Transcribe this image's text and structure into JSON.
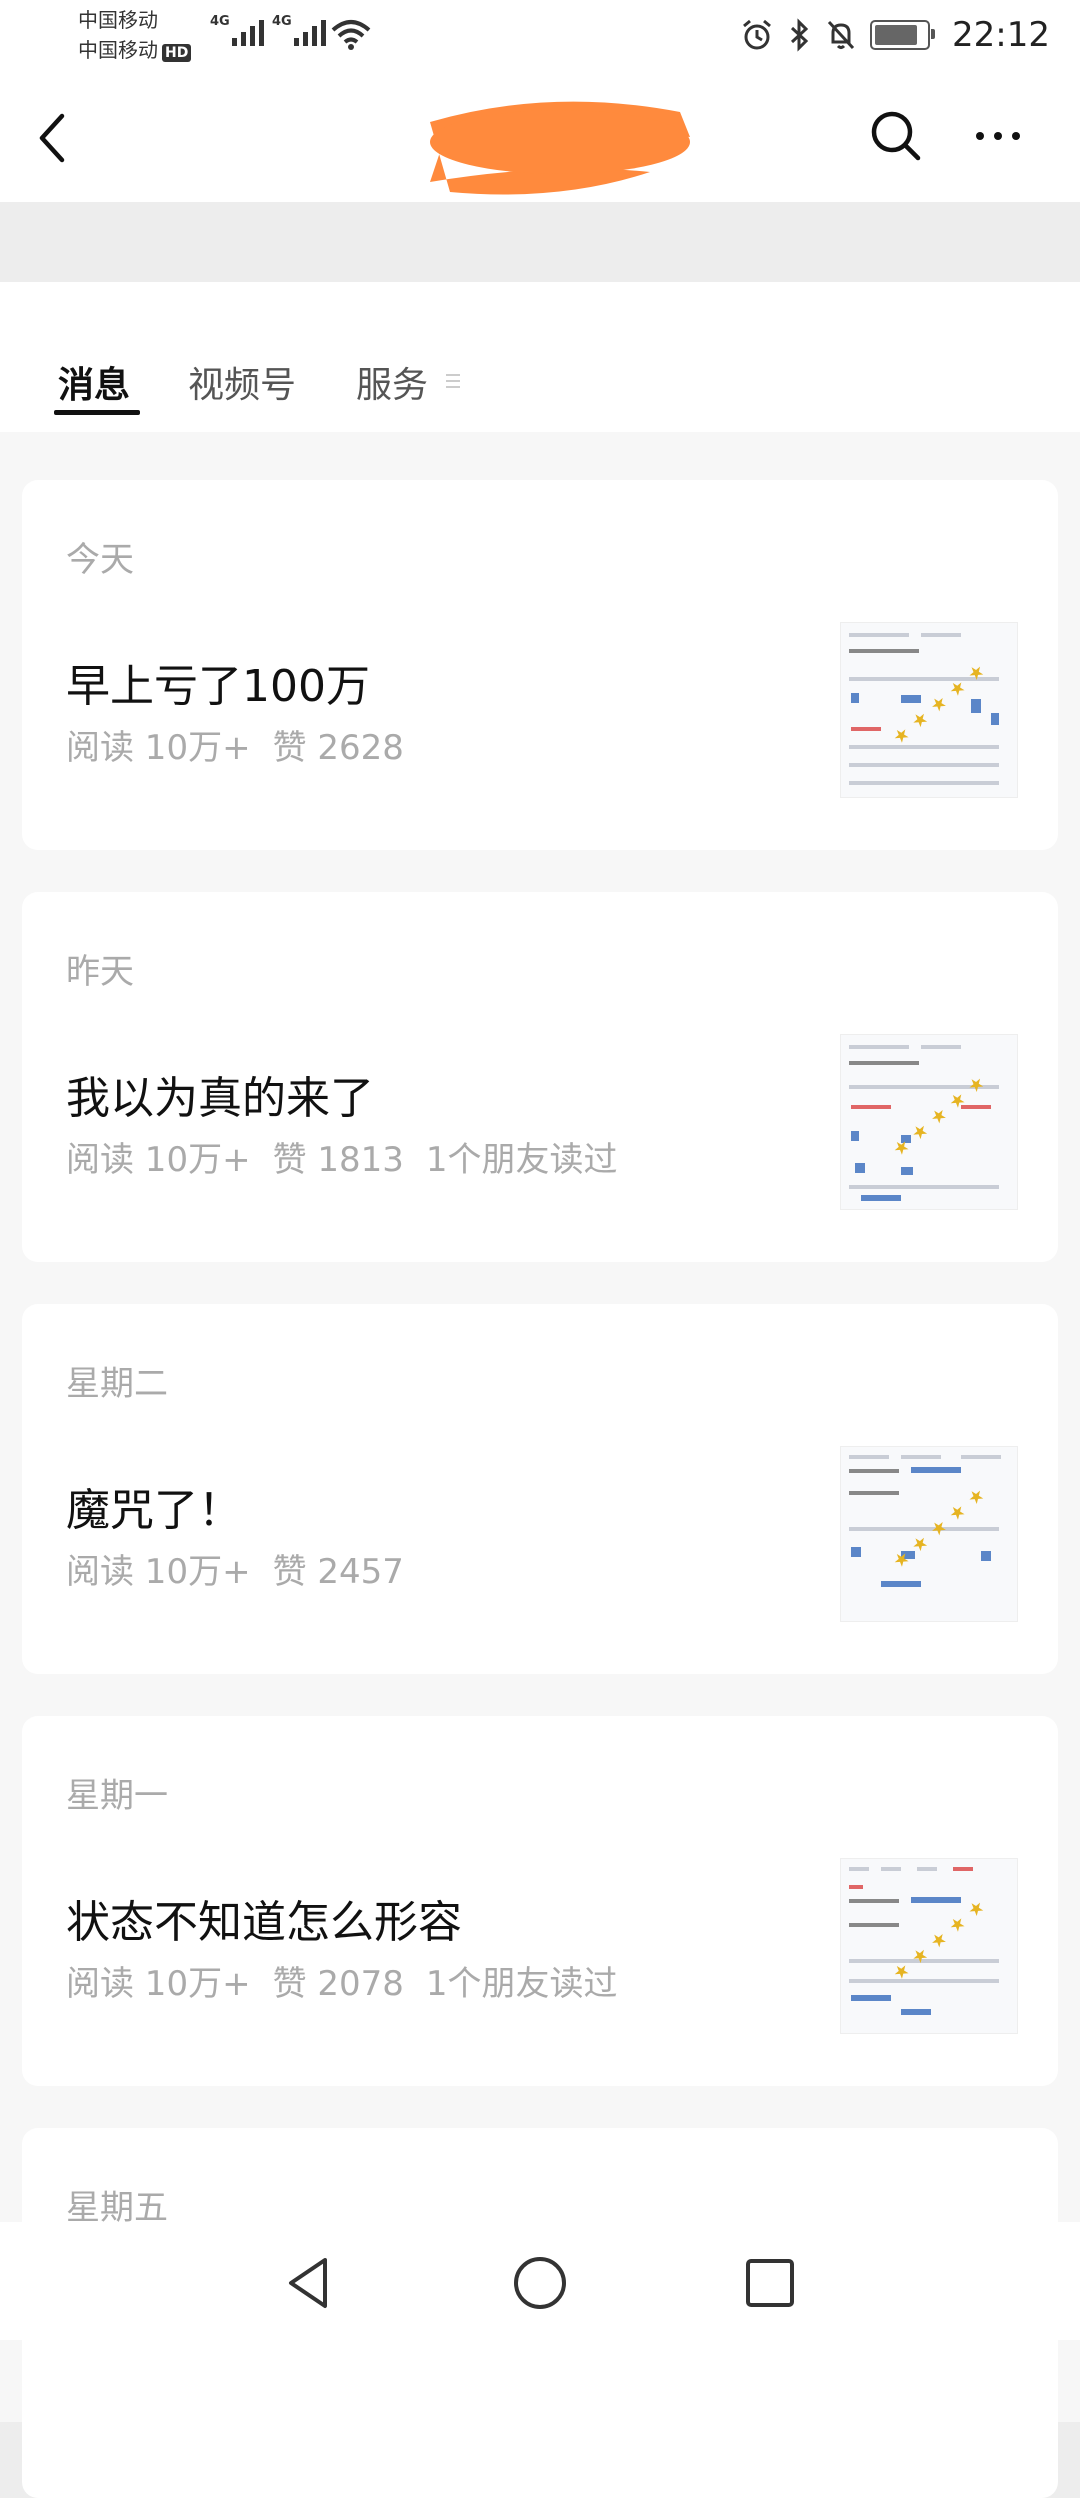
{
  "status_bar": {
    "carrier1": "中国移动",
    "carrier2": "中国移动",
    "hd_badge": "HD",
    "network1": "4G",
    "network2": "4G",
    "time": "22:12"
  },
  "header": {
    "title_redacted": true,
    "icons": [
      "back-icon",
      "search-icon",
      "more-icon"
    ]
  },
  "tabs": [
    {
      "label": "消息",
      "active": true
    },
    {
      "label": "视频号",
      "active": false
    },
    {
      "label": "服务",
      "active": false
    }
  ],
  "articles": [
    {
      "day": "今天",
      "title": "早上亏了100万",
      "reads": "阅读 10万+",
      "likes": "赞 2628",
      "friends": ""
    },
    {
      "day": "昨天",
      "title": "我以为真的来了",
      "reads": "阅读 10万+",
      "likes": "赞 1813",
      "friends": "1个朋友读过"
    },
    {
      "day": "星期二",
      "title": "魔咒了！",
      "reads": "阅读 10万+",
      "likes": "赞 2457",
      "friends": ""
    },
    {
      "day": "星期一",
      "title": "状态不知道怎么形容",
      "reads": "阅读 10万+",
      "likes": "赞 2078",
      "friends": "1个朋友读过"
    },
    {
      "day": "星期五",
      "title": "",
      "reads": "",
      "likes": "",
      "friends": ""
    }
  ],
  "colors": {
    "background": "#ededed",
    "card": "#ffffff",
    "redaction": "#ff8a3d",
    "muted_text": "#aaaaaa"
  },
  "navbar": {
    "icons": [
      "back-triangle-icon",
      "home-circle-icon",
      "recents-square-icon"
    ]
  }
}
